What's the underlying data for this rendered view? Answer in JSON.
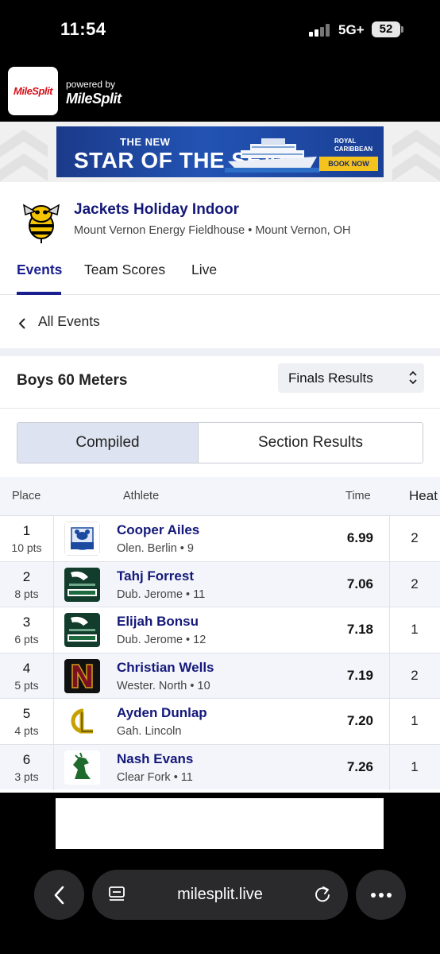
{
  "status_bar": {
    "time": "11:54",
    "network": "5G+",
    "battery": "52"
  },
  "header": {
    "logo_text": "MileSplit",
    "powered_by": "powered by",
    "brand": "MileSplit"
  },
  "ad": {
    "line1": "THE NEW",
    "line2": "STAR OF THE SEAS",
    "brand_line1": "ROYAL",
    "brand_line2": "CARIBBEAN",
    "cta": "BOOK NOW"
  },
  "meet": {
    "title": "Jackets Holiday Indoor",
    "venue": "Mount Vernon Energy Fieldhouse • Mount Vernon, OH"
  },
  "tabs": [
    {
      "label": "Events",
      "active": true
    },
    {
      "label": "Team Scores",
      "active": false
    },
    {
      "label": "Live",
      "active": false
    }
  ],
  "nav": {
    "back_label": "All Events"
  },
  "event": {
    "name": "Boys 60 Meters",
    "results_select": "Finals Results"
  },
  "toggle": {
    "compiled": "Compiled",
    "section": "Section Results",
    "selected": "Compiled"
  },
  "table": {
    "headers": {
      "place": "Place",
      "athlete": "Athlete",
      "time": "Time",
      "heat": "Heat"
    },
    "rows": [
      {
        "place": "1",
        "pts": "10 pts",
        "name": "Cooper Ailes",
        "meta": "Olen. Berlin • 9",
        "time": "6.99",
        "heat": "2",
        "logo": "berlin-bears-logo"
      },
      {
        "place": "2",
        "pts": "8 pts",
        "name": "Tahj Forrest",
        "meta": "Dub. Jerome • 11",
        "time": "7.06",
        "heat": "2",
        "logo": "celtics-logo"
      },
      {
        "place": "3",
        "pts": "6 pts",
        "name": "Elijah Bonsu",
        "meta": "Dub. Jerome • 12",
        "time": "7.18",
        "heat": "1",
        "logo": "celtics-logo"
      },
      {
        "place": "4",
        "pts": "5 pts",
        "name": "Christian Wells",
        "meta": "Wester. North • 10",
        "time": "7.19",
        "heat": "2",
        "logo": "north-logo"
      },
      {
        "place": "5",
        "pts": "4 pts",
        "name": "Ayden Dunlap",
        "meta": "Gah. Lincoln",
        "time": "7.20",
        "heat": "1",
        "logo": "lincoln-logo"
      },
      {
        "place": "6",
        "pts": "3 pts",
        "name": "Nash Evans",
        "meta": "Clear Fork • 11",
        "time": "7.26",
        "heat": "1",
        "logo": "colt-logo"
      }
    ]
  },
  "browser": {
    "url": "milesplit.live"
  },
  "colors": {
    "accent": "#1a1f8f",
    "link": "#14187a",
    "row_alt": "#f3f5fa",
    "select_bg": "#eef0f4"
  }
}
